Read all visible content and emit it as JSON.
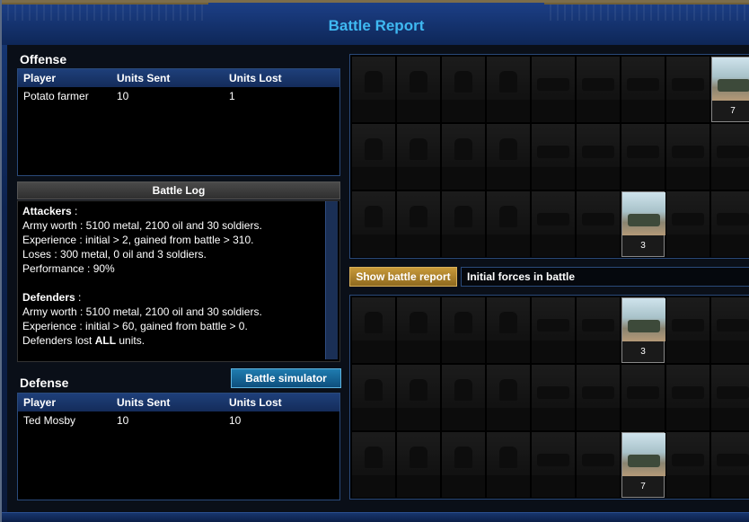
{
  "window": {
    "title": "Battle Report"
  },
  "offense": {
    "heading": "Offense",
    "columns": [
      "Player",
      "Units Sent",
      "Units Lost"
    ],
    "rows": [
      {
        "player": "Potato farmer",
        "sent": "10",
        "lost": "1"
      }
    ]
  },
  "battle_log": {
    "heading": "Battle Log",
    "lines": [
      {
        "label": "Attackers",
        "suffix": " :"
      },
      {
        "text": "Army worth : 5100 metal, 2100 oil and 30 soldiers."
      },
      {
        "text": "Experience : initial > 2, gained from battle > 310."
      },
      {
        "text": "Loses : 300 metal, 0 oil and 3 soldiers."
      },
      {
        "text": "Performance : 90%"
      },
      {
        "blank": true
      },
      {
        "label": "Defenders",
        "suffix": " :"
      },
      {
        "text": "Army worth : 5100 metal, 2100 oil and 30 soldiers."
      },
      {
        "text": "Experience : initial > 60, gained from battle > 0."
      },
      {
        "prefix": "Defenders lost ",
        "bold": "ALL",
        "rest": " units."
      }
    ]
  },
  "buttons": {
    "battle_simulator": "Battle simulator",
    "show_battle_report": "Show battle report"
  },
  "defense": {
    "heading": "Defense",
    "columns": [
      "Player",
      "Units Sent",
      "Units Lost"
    ],
    "rows": [
      {
        "player": "Ted Mosby",
        "sent": "10",
        "lost": "10"
      }
    ]
  },
  "forces_select": {
    "value": "Initial forces in battle"
  },
  "unit_grid_top": {
    "counts": [
      "",
      "",
      "",
      "",
      "",
      "",
      "",
      "",
      "7",
      "",
      "",
      "",
      "",
      "",
      "",
      "",
      "",
      "",
      "",
      "",
      "",
      "",
      "",
      "",
      "3",
      "",
      ""
    ]
  },
  "unit_grid_bottom": {
    "counts": [
      "",
      "",
      "",
      "",
      "",
      "",
      "3",
      "",
      "",
      "",
      "",
      "",
      "",
      "",
      "",
      "",
      "",
      "",
      "",
      "",
      "",
      "",
      "",
      "",
      "7",
      "",
      ""
    ]
  },
  "colors": {
    "title": "#3fb9f2",
    "accent_gold": "#c89a3a",
    "accent_blue": "#1f7cb0"
  }
}
